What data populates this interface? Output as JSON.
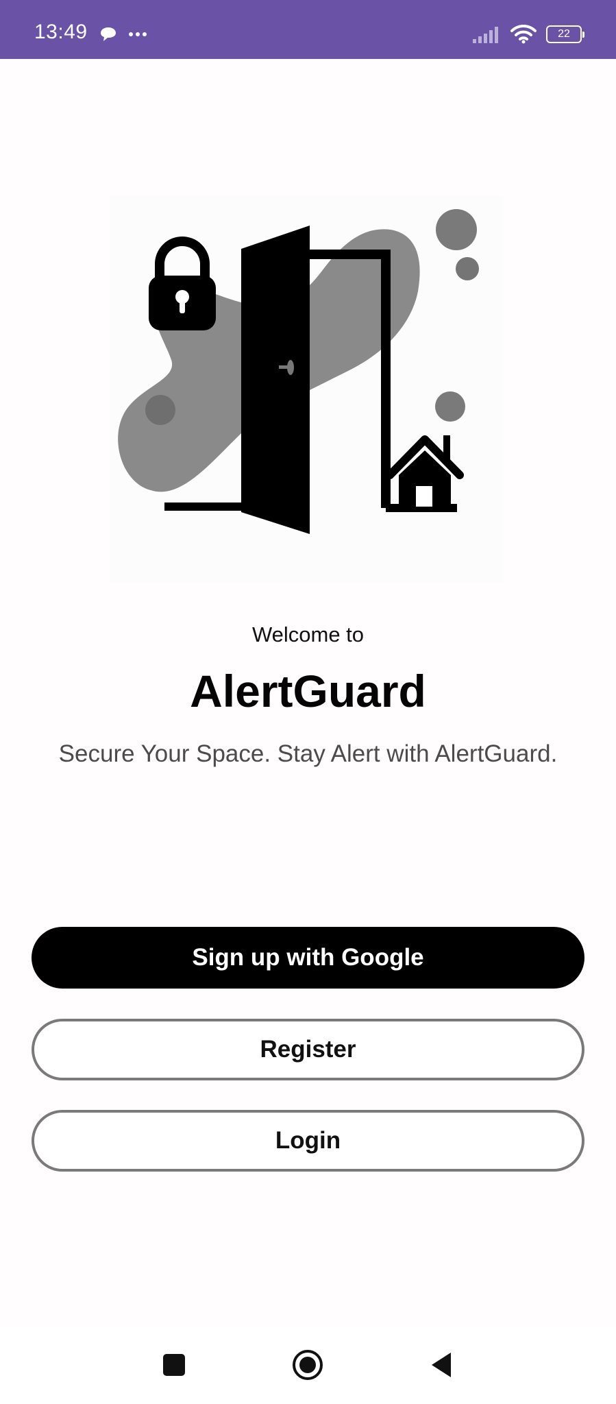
{
  "status_bar": {
    "time": "13:49",
    "battery": "22",
    "background_color": "#6a52a6"
  },
  "hero": {
    "illustration": "door-lock-home-illustration"
  },
  "content": {
    "welcome": "Welcome to",
    "app_name": "AlertGuard",
    "tagline": "Secure Your Space. Stay Alert with AlertGuard."
  },
  "buttons": {
    "google": "Sign up with Google",
    "register": "Register",
    "login": "Login"
  },
  "nav_bar": {
    "icons": [
      "recent-apps-icon",
      "home-icon",
      "back-icon"
    ]
  }
}
